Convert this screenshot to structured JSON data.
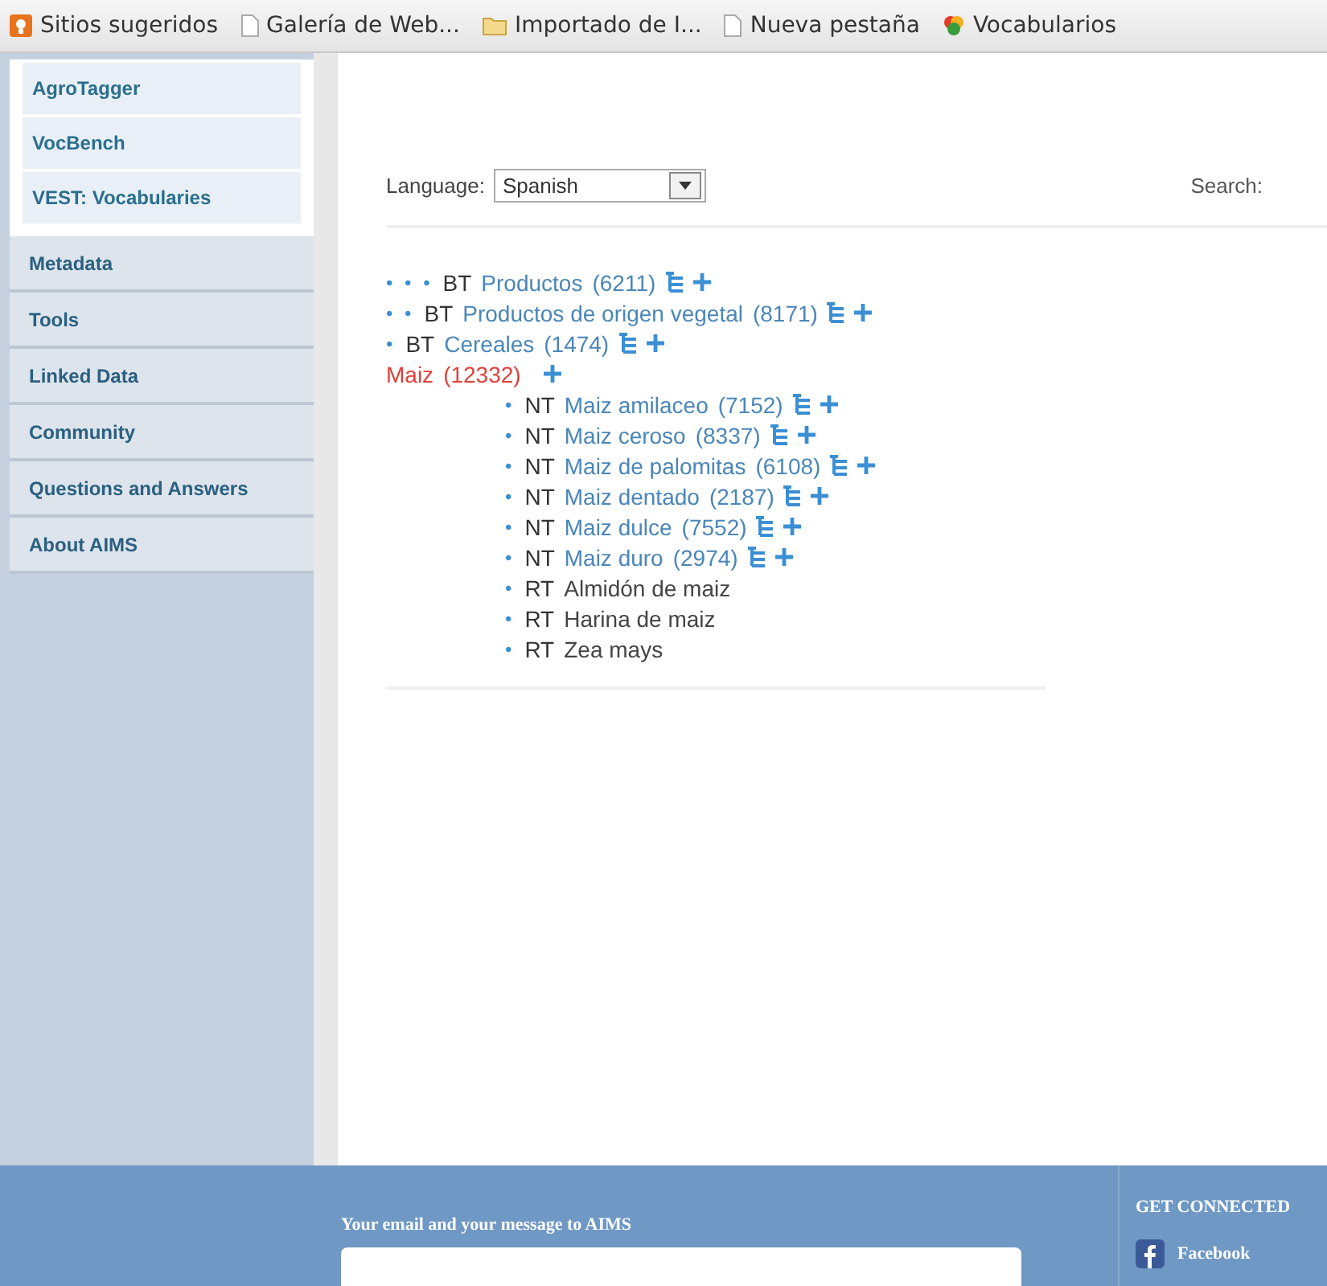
{
  "bookmarks": [
    {
      "kind": "suggested",
      "label": "Sitios sugeridos"
    },
    {
      "kind": "page",
      "label": "Galería de Web..."
    },
    {
      "kind": "folder",
      "label": "Importado de I..."
    },
    {
      "kind": "page",
      "label": "Nueva pestaña"
    },
    {
      "kind": "site",
      "label": "Vocabularios"
    }
  ],
  "sidebar": {
    "subitems": [
      "AgroTagger",
      "VocBench",
      "VEST: Vocabularies"
    ],
    "items": [
      "Metadata",
      "Tools",
      "Linked Data",
      "Community",
      "Questions and Answers",
      "About AIMS"
    ]
  },
  "language": {
    "label": "Language:",
    "value": "Spanish"
  },
  "search": {
    "label": "Search:"
  },
  "tree": [
    {
      "kind": "broader",
      "marker": "• • •",
      "relation": "BT",
      "label": "Productos",
      "count": "(6211)"
    },
    {
      "kind": "broader",
      "marker": "• •",
      "relation": "BT",
      "label": "Productos de origen vegetal",
      "count": "(8171)"
    },
    {
      "kind": "broader",
      "marker": "•",
      "relation": "BT",
      "label": "Cereales",
      "count": "(1474)"
    },
    {
      "kind": "current",
      "label": "Maiz",
      "count": "(12332)"
    },
    {
      "kind": "narrower",
      "marker": "•",
      "relation": "NT",
      "label": "Maiz amilaceo",
      "count": "(7152)"
    },
    {
      "kind": "narrower",
      "marker": "•",
      "relation": "NT",
      "label": "Maiz ceroso",
      "count": "(8337)"
    },
    {
      "kind": "narrower",
      "marker": "•",
      "relation": "NT",
      "label": "Maiz de palomitas",
      "count": "(6108)"
    },
    {
      "kind": "narrower",
      "marker": "•",
      "relation": "NT",
      "label": "Maiz dentado",
      "count": "(2187)"
    },
    {
      "kind": "narrower",
      "marker": "•",
      "relation": "NT",
      "label": "Maiz dulce",
      "count": "(7552)"
    },
    {
      "kind": "narrower",
      "marker": "•",
      "relation": "NT",
      "label": "Maiz duro",
      "count": "(2974)"
    },
    {
      "kind": "related",
      "marker": "•",
      "relation": "RT",
      "label": "Almidón de maiz"
    },
    {
      "kind": "related",
      "marker": "•",
      "relation": "RT",
      "label": "Harina de maiz"
    },
    {
      "kind": "related",
      "marker": "•",
      "relation": "RT",
      "label": "Zea mays"
    }
  ],
  "footer": {
    "message_label": "Your email and your message to AIMS",
    "connect_title": "GET CONNECTED",
    "social": [
      "Facebook"
    ]
  }
}
